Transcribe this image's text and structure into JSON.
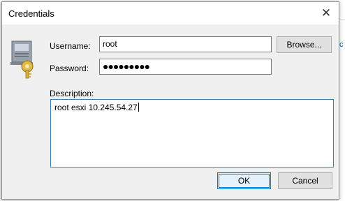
{
  "dialog": {
    "title": "Credentials",
    "close_glyph": "✕",
    "icon": "credential-key-icon"
  },
  "form": {
    "username_label": "Username:",
    "username_value": "root",
    "password_label": "Password:",
    "password_masked": "●●●●●●●●●",
    "description_label": "Description:",
    "description_value": "root esxi 10.245.54.27"
  },
  "buttons": {
    "browse": "Browse...",
    "ok": "OK",
    "cancel": "Cancel"
  },
  "background": {
    "link_fragment": "c"
  },
  "colors": {
    "accent": "#0078d7",
    "dialog_bg": "#f0f0f0"
  }
}
